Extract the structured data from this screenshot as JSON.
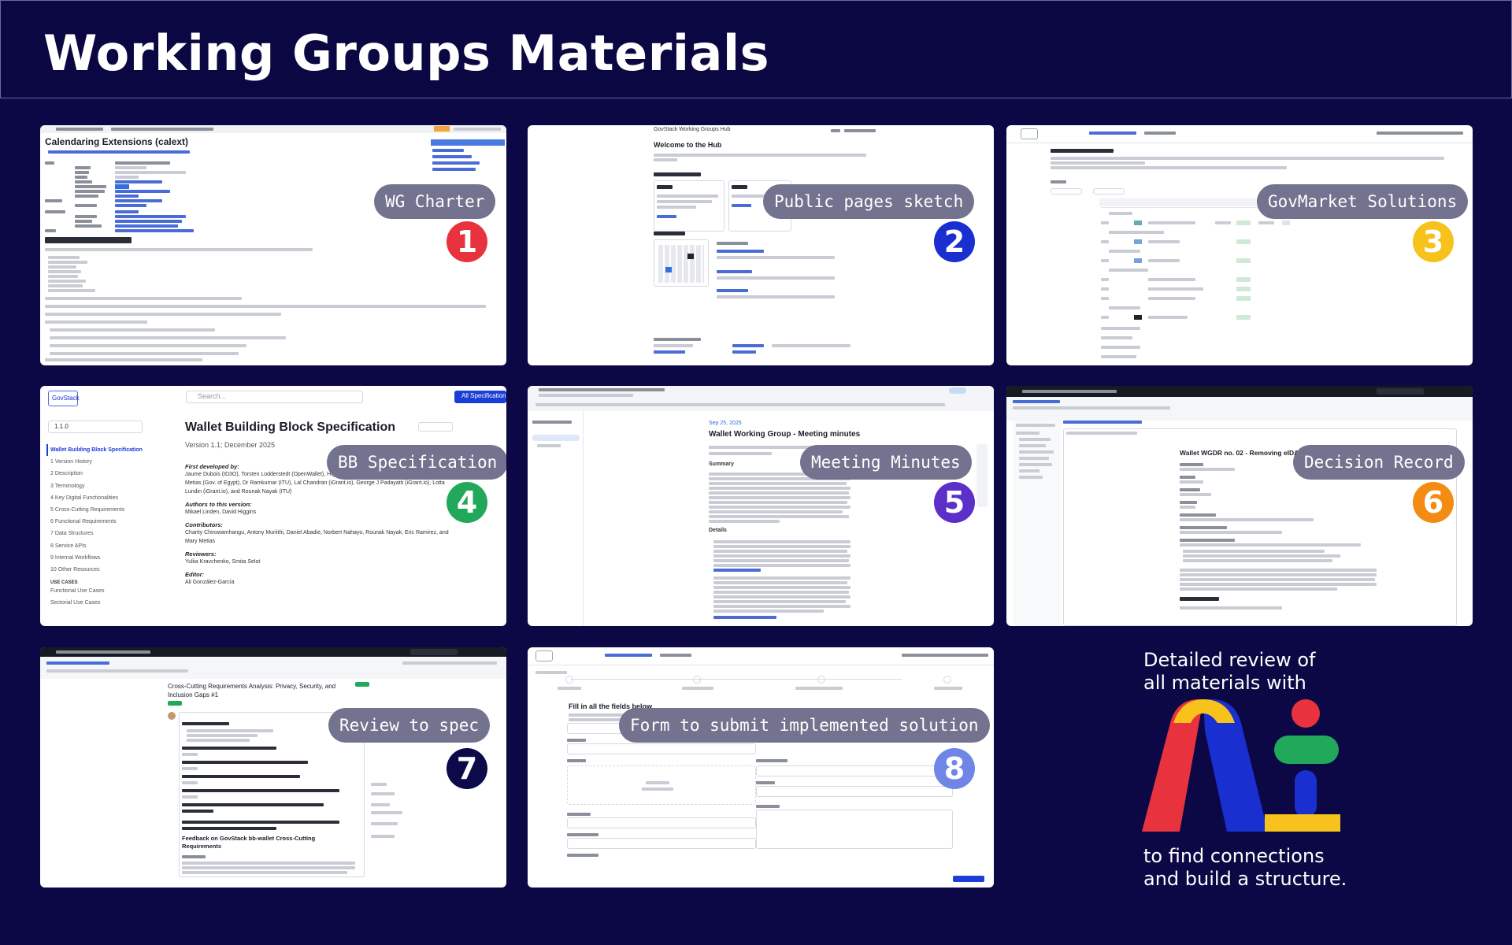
{
  "page": {
    "title": "Working Groups Materials"
  },
  "cards": [
    {
      "label": "WG Charter",
      "number": "1",
      "badge_color": "#e8333f",
      "shot_title": "Calendaring Extensions (calext)"
    },
    {
      "label": "Public pages sketch",
      "number": "2",
      "badge_color": "#1a2fd0",
      "shot_title": "Welcome to the Hub",
      "shot_header": "GovStack Working Groups Hub"
    },
    {
      "label": "GovMarket Solutions",
      "number": "3",
      "badge_color": "#f6c21b"
    },
    {
      "label": "BB Specification",
      "number": "4",
      "badge_color": "#22a85a",
      "shot_title": "Wallet Building Block Specification",
      "shot_subtitle": "Version 1.1; December 2025",
      "shot_search": "Search...",
      "shot_button": "All Specifications",
      "shot_version": "1.1.0",
      "nav_items": [
        "Wallet Building Block Specification",
        "1 Version History",
        "2 Description",
        "3 Terminology",
        "4 Key Digital Functionalities",
        "5 Cross-Cutting Requirements",
        "6 Functional Requirements",
        "7 Data Structures",
        "8 Service APIs",
        "9 Internal Workflows",
        "10 Other Resources"
      ],
      "nav_section": "USE CASES",
      "nav_uc": [
        "Functional Use Cases",
        "Sectorial Use Cases"
      ],
      "sections": [
        {
          "head": "First developed by:",
          "body": "Jaume Dubois (ID3O), Torsten Lodderstedt (OpenWallet), Higgins (Mifos Initiative), Abbie Barbir (ITU), Mary Metias (Gov. of Egypt), Dr Ramkumar (ITU), Lal Chandran (iGrant.io), George J Padayatti (iGrant.io), Lotta Lundin (iGrant.io), and Rounak Nayak (ITU)"
        },
        {
          "head": "Authors to this version:",
          "body": "Mikael Linden, David Higgins"
        },
        {
          "head": "Contributors:",
          "body": "Charity Chirowamhangu, Antony Muriithi, Daniel Abadie, Norbert Nahayo, Rounak Nayak, Eric Ramirez, and Mary Metias"
        },
        {
          "head": "Reviewers:",
          "body": "Yuliia Kravchenko, Smita Selot"
        },
        {
          "head": "Editor:",
          "body": "Ali González-García"
        }
      ]
    },
    {
      "label": "Meeting Minutes",
      "number": "5",
      "badge_color": "#5b2fc8",
      "shot_title": "Wallet Working Group - Meeting minutes",
      "shot_date": "Sep 25, 2025",
      "shot_h_summary": "Summary",
      "shot_h_details": "Details"
    },
    {
      "label": "Decision Record",
      "number": "6",
      "badge_color": "#f28c12",
      "shot_title": "Wallet WGDR no. 02 - Removing eIDAS as a requirement"
    },
    {
      "label": "Review to spec",
      "number": "7",
      "badge_color": "#0d0a4a",
      "shot_title": "Cross-Cutting Requirements Analysis: Privacy, Security, and Inclusion Gaps #1",
      "shot_h2": "Feedback on GovStack bb-wallet Cross-Cutting Requirements"
    },
    {
      "label": "Form to submit implemented solution",
      "number": "8",
      "badge_color": "#6f86e6",
      "shot_title": "Fill in all the fields below"
    }
  ],
  "ai_panel": {
    "top_text_1": "Detailed review of",
    "top_text_2": "all materials with",
    "bottom_text_1": "to find connections",
    "bottom_text_2": "and build a structure.",
    "logo_colors": {
      "red": "#e8333f",
      "yellow": "#f6c21b",
      "blue": "#1a2fd0",
      "green": "#22a85a"
    }
  }
}
